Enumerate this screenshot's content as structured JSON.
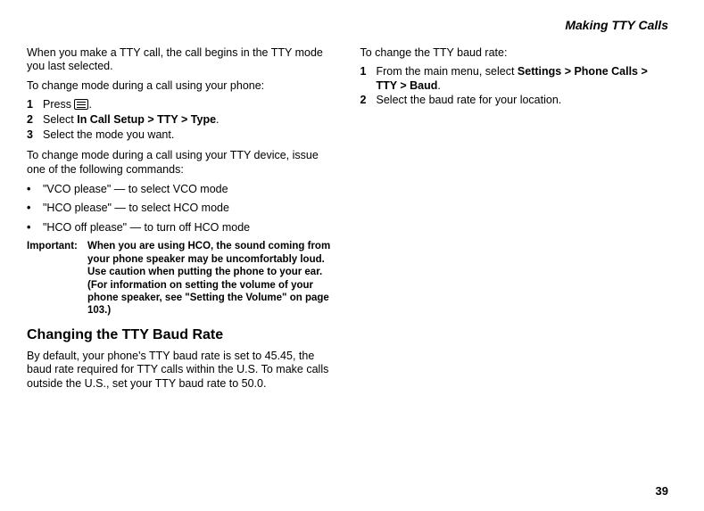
{
  "header": "Making TTY Calls",
  "left": {
    "p1": "When you make a TTY call, the call begins in the TTY mode you last selected.",
    "p2": "To change mode during a call using your phone:",
    "steps1": [
      {
        "pre": "Press ",
        "post": "."
      },
      {
        "pre": "Select ",
        "bold": "In Call Setup > TTY > Type",
        "post": "."
      },
      {
        "pre": "Select the mode you want.",
        "bold": "",
        "post": ""
      }
    ],
    "p3": "To change mode during a call using your TTY device, issue one of the following commands:",
    "bullets": [
      "\"VCO please\" — to select VCO mode",
      "\"HCO please\" — to select HCO mode",
      "\"HCO off please\" — to turn off HCO mode"
    ],
    "importantLabel": "Important:",
    "importantBody": "When you are using HCO, the sound coming from your phone speaker may be uncomfortably loud. Use caution when putting the phone to your ear. (For information on setting the volume of your phone speaker, see \"Setting the Volume\" on page 103.)",
    "h2": "Changing the TTY Baud Rate",
    "p4": "By default, your phone's TTY baud rate is set to 45.45, the baud rate required for TTY calls within the U.S. To make calls outside the U.S., set your TTY baud rate to 50.0."
  },
  "right": {
    "p1": "To change the TTY baud rate:",
    "steps": [
      {
        "pre": "From the main menu, select ",
        "bold": "Settings > Phone Calls > TTY > Baud",
        "post": "."
      },
      {
        "pre": "Select the baud rate for your location.",
        "bold": "",
        "post": ""
      }
    ]
  },
  "pageNumber": "39"
}
